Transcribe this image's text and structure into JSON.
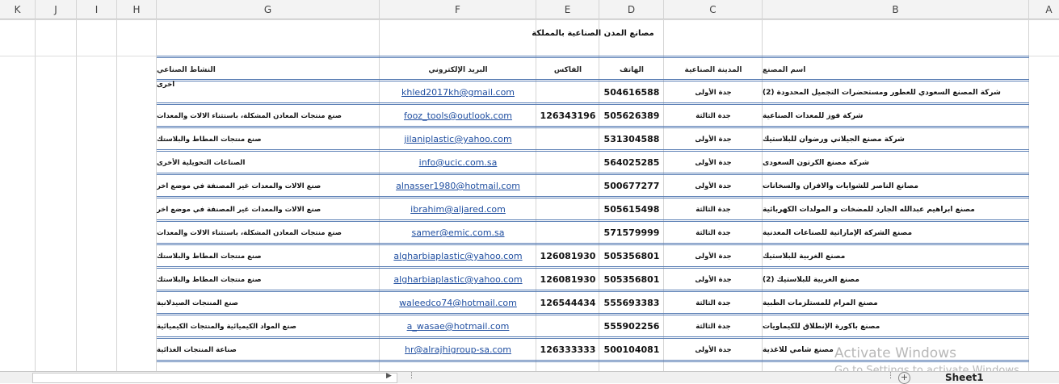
{
  "columns": [
    "K",
    "J",
    "I",
    "H",
    "G",
    "F",
    "E",
    "D",
    "C",
    "B",
    "A"
  ],
  "title": "مصانع المدن الصناعية بالمملكة",
  "headers": {
    "name": "اسم المصنع",
    "city": "المدينة الصناعية",
    "phone": "الهاتف",
    "fax": "الفاكس",
    "email": "البريد الإلكتروني",
    "activity": "النشاط الصناعي"
  },
  "rows": [
    {
      "name": "شركة المصنع السعودي للعطور ومستحضرات التجميل المحدودة (2)",
      "city": "جدة الأولى",
      "phone": "504616588",
      "fax": "",
      "email": "khled2017kh@gmail.com",
      "activity": "أخرى"
    },
    {
      "name": "شركة فوز للمعدات الصناعية",
      "city": "جدة الثالثة",
      "phone": "505626389",
      "fax": "126343196",
      "email": "fooz_tools@outlook.com",
      "activity": "صنع منتجات المعادن المشكلة، باستثناء الالات والمعدات"
    },
    {
      "name": "شركة مصنع الجيلاني ورضوان للبلاستيك",
      "city": "جدة الأولى",
      "phone": "531304588",
      "fax": "",
      "email": "jilaniplastic@yahoo.com",
      "activity": "صنع منتجات المطاط والبلاستك"
    },
    {
      "name": "شركة مصنع الكرتون السعودى",
      "city": "جدة الأولى",
      "phone": "564025285",
      "fax": "",
      "email": "info@ucic.com.sa",
      "activity": "الصناعات التحويلية الأخرى"
    },
    {
      "name": "مصانع الناصر للشوايات والافران والسخانات",
      "city": "جدة الأولى",
      "phone": "500677277",
      "fax": "",
      "email": "alnasser1980@hotmail.com",
      "activity": "صنع الالات والمعدات غير المصنفة في موضع اخر"
    },
    {
      "name": "مصنع ابراهيم عبدالله الجارد للمضخات و المولدات الكهربائية",
      "city": "جدة الثالثة",
      "phone": "505615498",
      "fax": "",
      "email": "ibrahim@aljared.com",
      "activity": "صنع الالات والمعدات غير المصنفة في موضع اخر"
    },
    {
      "name": "مصنع الشركة الإماراتية للصناعات المعدنية",
      "city": "جدة الثالثة",
      "phone": "571579999",
      "fax": "",
      "email": "samer@emic.com.sa",
      "activity": "صنع منتجات المعادن المشكلة، باستثناء الالات والمعدات"
    },
    {
      "name": "مصنع الغربية للبلاستيك",
      "city": "جدة الأولى",
      "phone": "505356801",
      "fax": "126081930",
      "email": "algharbiaplastic@yahoo.com",
      "activity": "صنع منتجات المطاط والبلاستك"
    },
    {
      "name": "مصنع الغربية للبلاستيك (2)",
      "city": "جدة الأولى",
      "phone": "505356801",
      "fax": "126081930",
      "email": "algharbiaplastic@yahoo.com",
      "activity": "صنع منتجات المطاط والبلاستك"
    },
    {
      "name": "مصنع المرام للمستلزمات الطبية",
      "city": "جدة الثالثة",
      "phone": "555693383",
      "fax": "126544434",
      "email": "waleedco74@hotmail.com",
      "activity": "صنع المنتجات الصيدلانية"
    },
    {
      "name": "مصنع باكورة الإنطلاق للكيماويات",
      "city": "جدة الثالثة",
      "phone": "555902256",
      "fax": "",
      "email": "a_wasae@hotmail.com",
      "activity": "صنع المواد الكيميائية والمنتجات الكيميائية"
    },
    {
      "name": "مصنع شامي للاغذية",
      "city": "جدة الأولى",
      "phone": "500104081",
      "fax": "126333333",
      "email": "hr@alrajhigroup-sa.com",
      "activity": "صناعة المنتجات الغذائية"
    }
  ],
  "sheet_tab": "Sheet1",
  "watermark": {
    "line1": "Activate Windows",
    "line2": "Go to Settings to activate Windows."
  }
}
